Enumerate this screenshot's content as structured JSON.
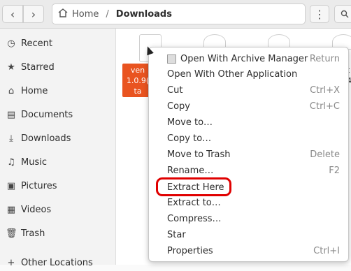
{
  "header": {
    "back_icon": "chevron-left-icon",
    "forward_icon": "chevron-right-icon",
    "path_home": "Home",
    "path_sep": "/",
    "path_current": "Downloads",
    "menu_icon": "⋮"
  },
  "sidebar": {
    "items": [
      {
        "label": "Recent",
        "icon": "clock-icon"
      },
      {
        "label": "Starred",
        "icon": "star-icon"
      },
      {
        "label": "Home",
        "icon": "home-icon"
      },
      {
        "label": "Documents",
        "icon": "document-icon"
      },
      {
        "label": "Downloads",
        "icon": "download-icon"
      },
      {
        "label": "Music",
        "icon": "music-icon"
      },
      {
        "label": "Pictures",
        "icon": "picture-icon"
      },
      {
        "label": "Videos",
        "icon": "video-icon"
      },
      {
        "label": "Trash",
        "icon": "trash-icon"
      },
      {
        "label": "Other Locations",
        "icon": "plus-icon"
      }
    ]
  },
  "files": {
    "selected_name_lines": [
      "ven",
      "1.0.9(",
      "ta"
    ],
    "right_fragment": [
      "t",
      "4."
    ]
  },
  "context_menu": {
    "items": [
      {
        "label": "Open With Archive Manager",
        "accel": "Return"
      },
      {
        "label": "Open With Other Application",
        "accel": ""
      },
      {
        "label": "Cut",
        "accel": "Ctrl+X"
      },
      {
        "label": "Copy",
        "accel": "Ctrl+C"
      },
      {
        "label": "Move to…",
        "accel": ""
      },
      {
        "label": "Copy to…",
        "accel": ""
      },
      {
        "label": "Move to Trash",
        "accel": "Delete"
      },
      {
        "label": "Rename…",
        "accel": "F2"
      },
      {
        "label": "Extract Here",
        "accel": ""
      },
      {
        "label": "Extract to…",
        "accel": ""
      },
      {
        "label": "Compress…",
        "accel": ""
      },
      {
        "label": "Star",
        "accel": ""
      },
      {
        "label": "Properties",
        "accel": "Ctrl+I"
      }
    ],
    "highlighted_item": "Extract Here",
    "highlight_color": "#e00000"
  },
  "colors": {
    "accent": "#e95420"
  }
}
